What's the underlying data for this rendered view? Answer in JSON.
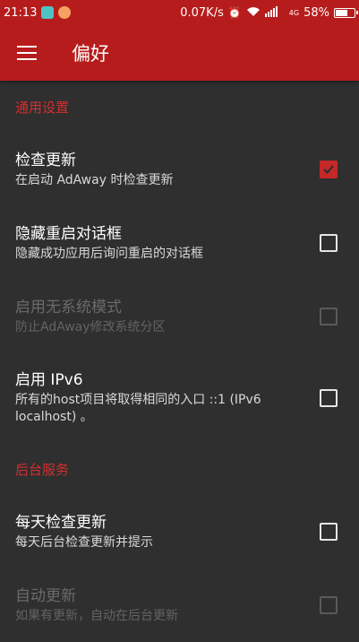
{
  "status_bar": {
    "time": "21:13",
    "speed": "0.07K/s",
    "signal_label": "4G",
    "battery": "58%"
  },
  "toolbar": {
    "title": "偏好"
  },
  "sections": {
    "general": {
      "header": "通用设置",
      "items": [
        {
          "title": "检查更新",
          "summary": "在启动 AdAway 时检查更新",
          "checked": true,
          "enabled": true
        },
        {
          "title": "隐藏重启对话框",
          "summary": "隐藏成功应用后询问重启的对话框",
          "checked": false,
          "enabled": true
        },
        {
          "title": "启用无系统模式",
          "summary": "防止AdAway修改系统分区",
          "checked": false,
          "enabled": false
        },
        {
          "title": "启用 IPv6",
          "summary": "所有的host项目将取得相同的入口 ::1 (IPv6 localhost) 。",
          "checked": false,
          "enabled": true
        }
      ]
    },
    "background": {
      "header": "后台服务",
      "items": [
        {
          "title": "每天检查更新",
          "summary": "每天后台检查更新并提示",
          "checked": false,
          "enabled": true
        },
        {
          "title": "自动更新",
          "summary": "如果有更新，自动在后台更新",
          "checked": false,
          "enabled": false
        }
      ]
    }
  },
  "colors": {
    "accent": "#b71c1c",
    "background": "#2f2f2f",
    "section_header": "#d32f2f"
  }
}
